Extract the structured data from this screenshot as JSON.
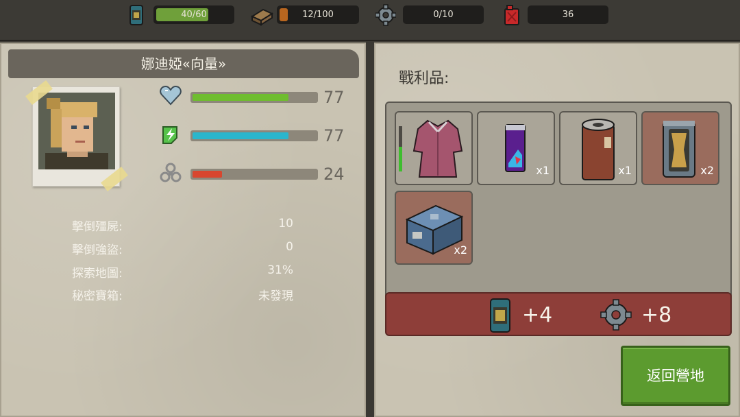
{
  "resources": {
    "food": {
      "icon": "food-can-icon",
      "value": "40/60",
      "fill": 0.667,
      "color": "#6fa03a"
    },
    "wood": {
      "icon": "wood-plank-icon",
      "value": "12/100",
      "fill": 0.12,
      "color": "#b8661f"
    },
    "parts": {
      "icon": "gear-icon",
      "value": "0/10"
    },
    "fuel": {
      "icon": "fuel-can-icon",
      "value": "36"
    }
  },
  "character": {
    "name": "娜迪婭«向量»",
    "portrait_icon": "character-portrait"
  },
  "stats": [
    {
      "icon": "heart-icon",
      "value": "77",
      "fill": 0.77,
      "color": "#6fbd2f"
    },
    {
      "icon": "energy-bolt-icon",
      "value": "77",
      "fill": 0.77,
      "color": "#2bb6cc"
    },
    {
      "icon": "biohazard-icon",
      "value": "24",
      "fill": 0.24,
      "color": "#d8462f"
    }
  ],
  "records": [
    {
      "label": "擊倒殭屍:",
      "value": "10"
    },
    {
      "label": "擊倒強盜:",
      "value": "0"
    },
    {
      "label": "探索地圖:",
      "value": "31%"
    },
    {
      "label": "秘密寶箱:",
      "value": "未發現"
    }
  ],
  "loot": {
    "title": "戰利品:",
    "items": [
      {
        "icon": "pink-dress-icon",
        "qty": "",
        "highlight": false,
        "durability": 0.55
      },
      {
        "icon": "energy-drink-can-icon",
        "qty": "x1",
        "highlight": false
      },
      {
        "icon": "brown-barrel-can-icon",
        "qty": "x1",
        "highlight": false
      },
      {
        "icon": "gold-can-icon",
        "qty": "x2",
        "highlight": true
      },
      {
        "icon": "blue-box-icon",
        "qty": "x2",
        "highlight": true
      }
    ],
    "rewards": [
      {
        "icon": "food-can-icon",
        "value": "+4"
      },
      {
        "icon": "gear-icon",
        "value": "+8"
      }
    ]
  },
  "return_button": "返回營地"
}
